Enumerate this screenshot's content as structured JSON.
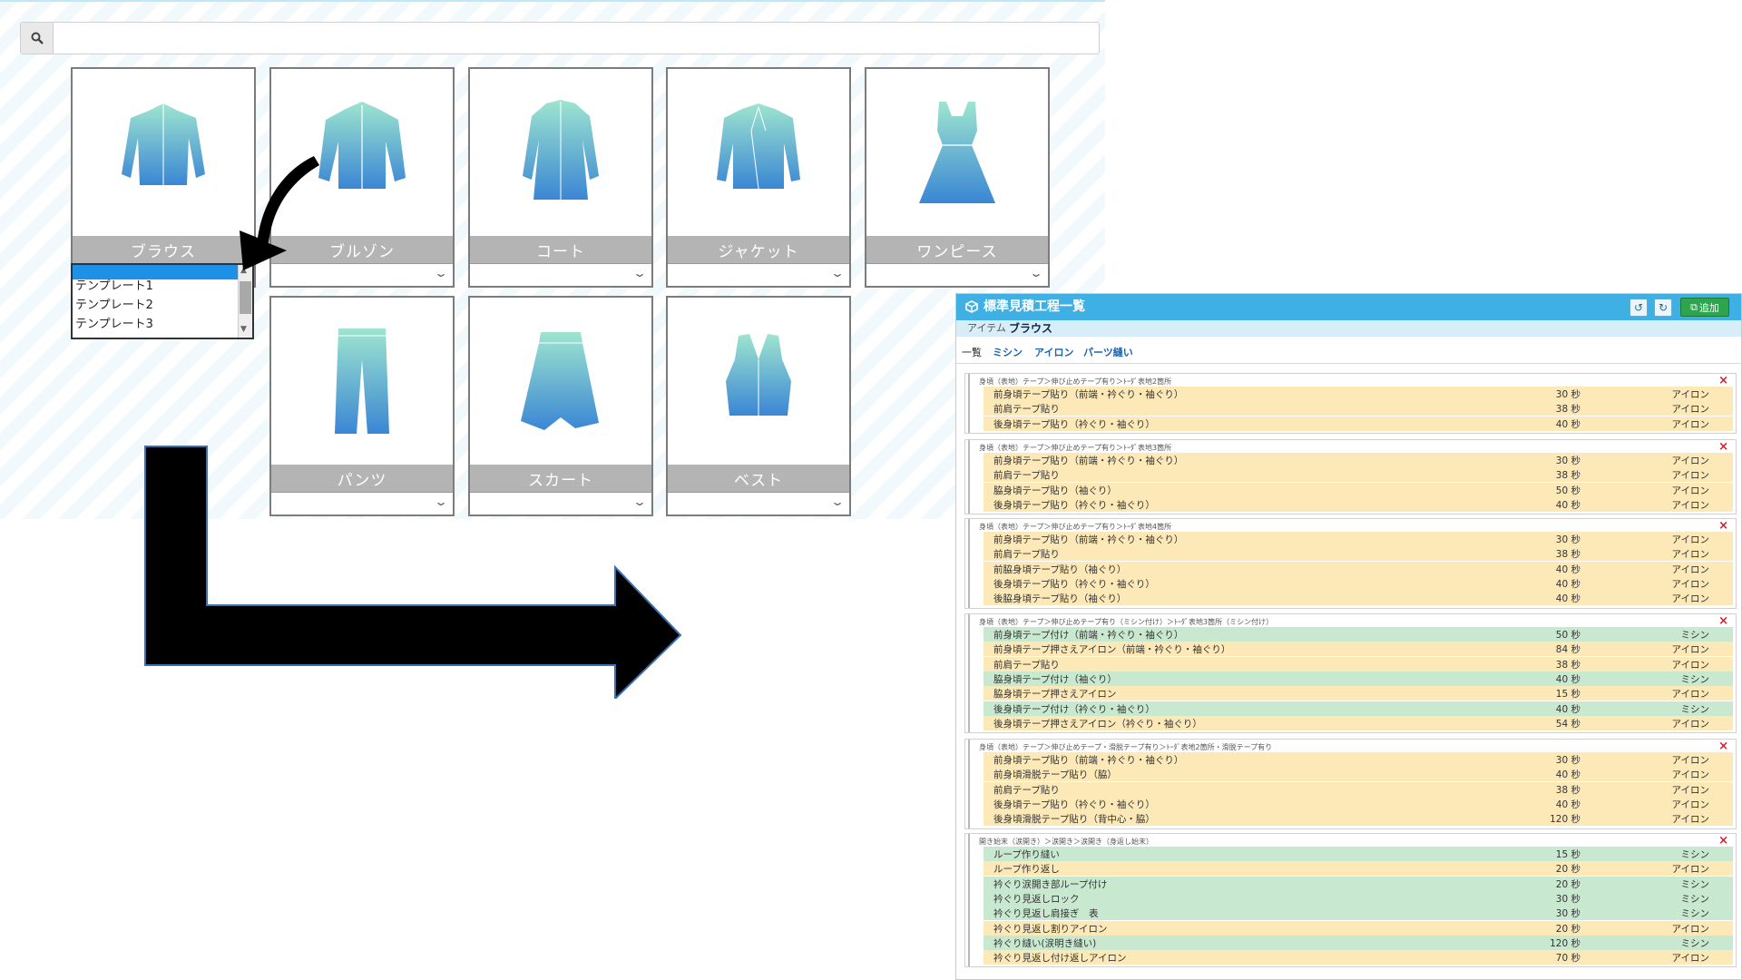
{
  "selector": {
    "search_placeholder": "",
    "garments": [
      {
        "label": "ブラウス"
      },
      {
        "label": "ブルゾン"
      },
      {
        "label": "コート"
      },
      {
        "label": "ジャケット"
      },
      {
        "label": "ワンピース"
      },
      {
        "label": "パンツ"
      },
      {
        "label": "スカート"
      },
      {
        "label": "ベスト"
      }
    ],
    "dropdown_options": [
      "テンプレート1",
      "テンプレート2",
      "テンプレート3"
    ]
  },
  "panel": {
    "title": "標準見積工程一覧",
    "add_label": "追加",
    "item_key": "アイテム",
    "item_value": "ブラウス",
    "tabs": [
      "一覧",
      "ミシン",
      "アイロン",
      "パーツ縫い"
    ]
  },
  "groups": [
    {
      "header": "身頃（表地）テープ＞伸び止めテープ有り＞ﾄｰﾀﾞ表地2箇所",
      "rows": [
        {
          "name": "前身頃テープ貼り（前端・衿ぐり・袖ぐり）",
          "time": "30 秒",
          "machine": "アイロン",
          "kind": "ir"
        },
        {
          "name": "前肩テープ貼り",
          "time": "38 秒",
          "machine": "アイロン",
          "kind": "ir"
        },
        {
          "name": "後身頃テープ貼り（衿ぐり・袖ぐり）",
          "time": "40 秒",
          "machine": "アイロン",
          "kind": "ir"
        }
      ]
    },
    {
      "header": "身頃（表地）テープ＞伸び止めテープ有り＞ﾄｰﾀﾞ表地3箇所",
      "rows": [
        {
          "name": "前身頃テープ貼り（前端・衿ぐり・袖ぐり）",
          "time": "30 秒",
          "machine": "アイロン",
          "kind": "ir"
        },
        {
          "name": "前肩テープ貼り",
          "time": "38 秒",
          "machine": "アイロン",
          "kind": "ir"
        },
        {
          "name": "脇身頃テープ貼り（袖ぐり）",
          "time": "50 秒",
          "machine": "アイロン",
          "kind": "ir"
        },
        {
          "name": "後身頃テープ貼り（衿ぐり・袖ぐり）",
          "time": "40 秒",
          "machine": "アイロン",
          "kind": "ir"
        }
      ]
    },
    {
      "header": "身頃（表地）テープ＞伸び止めテープ有り＞ﾄｰﾀﾞ表地4箇所",
      "rows": [
        {
          "name": "前身頃テープ貼り（前端・衿ぐり・袖ぐり）",
          "time": "30 秒",
          "machine": "アイロン",
          "kind": "ir"
        },
        {
          "name": "前肩テープ貼り",
          "time": "38 秒",
          "machine": "アイロン",
          "kind": "ir"
        },
        {
          "name": "前脇身頃テープ貼り（袖ぐり）",
          "time": "40 秒",
          "machine": "アイロン",
          "kind": "ir"
        },
        {
          "name": "後身頃テープ貼り（衿ぐり・袖ぐり）",
          "time": "40 秒",
          "machine": "アイロン",
          "kind": "ir"
        },
        {
          "name": "後脇身頃テープ貼り（袖ぐり）",
          "time": "40 秒",
          "machine": "アイロン",
          "kind": "ir"
        }
      ]
    },
    {
      "header": "身頃（表地）テープ＞伸び止めテープ有り（ミシン付け）＞ﾄｰﾀﾞ表地3箇所（ミシン付け）",
      "rows": [
        {
          "name": "前身頃テープ付け（前端・衿ぐり・袖ぐり）",
          "time": "50 秒",
          "machine": "ミシン",
          "kind": "ms"
        },
        {
          "name": "前身頃テープ押さえアイロン（前端・衿ぐり・袖ぐり）",
          "time": "84 秒",
          "machine": "アイロン",
          "kind": "ir"
        },
        {
          "name": "前肩テープ貼り",
          "time": "38 秒",
          "machine": "アイロン",
          "kind": "ir"
        },
        {
          "name": "脇身頃テープ付け（袖ぐり）",
          "time": "40 秒",
          "machine": "ミシン",
          "kind": "ms"
        },
        {
          "name": "脇身頃テープ押さえアイロン",
          "time": "15 秒",
          "machine": "アイロン",
          "kind": "ir"
        },
        {
          "name": "後身頃テープ付け（衿ぐり・袖ぐり）",
          "time": "40 秒",
          "machine": "ミシン",
          "kind": "ms"
        },
        {
          "name": "後身頃テープ押さえアイロン（衿ぐり・袖ぐり）",
          "time": "54 秒",
          "machine": "アイロン",
          "kind": "ir"
        }
      ]
    },
    {
      "header": "身頃（表地）テープ＞伸び止めテープ・滑脱テープ有り＞ﾄｰﾀﾞ表地2箇所・滑脱テープ有り",
      "rows": [
        {
          "name": "前身頃テープ貼り（前端・衿ぐり・袖ぐり）",
          "time": "30 秒",
          "machine": "アイロン",
          "kind": "ir"
        },
        {
          "name": "前身頃滑脱テープ貼り（脇）",
          "time": "40 秒",
          "machine": "アイロン",
          "kind": "ir"
        },
        {
          "name": "前肩テープ貼り",
          "time": "38 秒",
          "machine": "アイロン",
          "kind": "ir"
        },
        {
          "name": "後身頃テープ貼り（衿ぐり・袖ぐり）",
          "time": "40 秒",
          "machine": "アイロン",
          "kind": "ir"
        },
        {
          "name": "後身頃滑脱テープ貼り（背中心・脇）",
          "time": "120 秒",
          "machine": "アイロン",
          "kind": "ir"
        }
      ]
    },
    {
      "header": "開き始末（涙開き）＞涙開き＞涙開き（身返し始末）",
      "rows": [
        {
          "name": "ループ作り縫い",
          "time": "15 秒",
          "machine": "ミシン",
          "kind": "ms"
        },
        {
          "name": "ループ作り返し",
          "time": "20 秒",
          "machine": "アイロン",
          "kind": "ir"
        },
        {
          "name": "衿ぐり涙開き部ループ付け",
          "time": "20 秒",
          "machine": "ミシン",
          "kind": "ms"
        },
        {
          "name": "衿ぐり見返しロック",
          "time": "30 秒",
          "machine": "ミシン",
          "kind": "ms"
        },
        {
          "name": "衿ぐり見返し肩接ぎ　表",
          "time": "30 秒",
          "machine": "ミシン",
          "kind": "ms"
        },
        {
          "name": "衿ぐり見返し割りアイロン",
          "time": "20 秒",
          "machine": "アイロン",
          "kind": "ir"
        },
        {
          "name": "衿ぐり縫い(涙明き縫い)",
          "time": "120 秒",
          "machine": "ミシン",
          "kind": "ms"
        },
        {
          "name": "衿ぐり見返し付け返しアイロン",
          "time": "70 秒",
          "machine": "アイロン",
          "kind": "ir"
        }
      ]
    }
  ],
  "colors": {
    "header_blue": "#3fb0e4",
    "iron_row": "#fde9b8",
    "sewing_row": "#c8e8d0",
    "add_green": "#2ea44f",
    "garment_top": "#9ee5cf",
    "garment_bottom": "#3a86d4"
  },
  "icons": {
    "search": "search-icon",
    "undo": "undo-icon",
    "refresh": "refresh-icon",
    "add": "copy-add-icon",
    "title": "cube-icon"
  }
}
